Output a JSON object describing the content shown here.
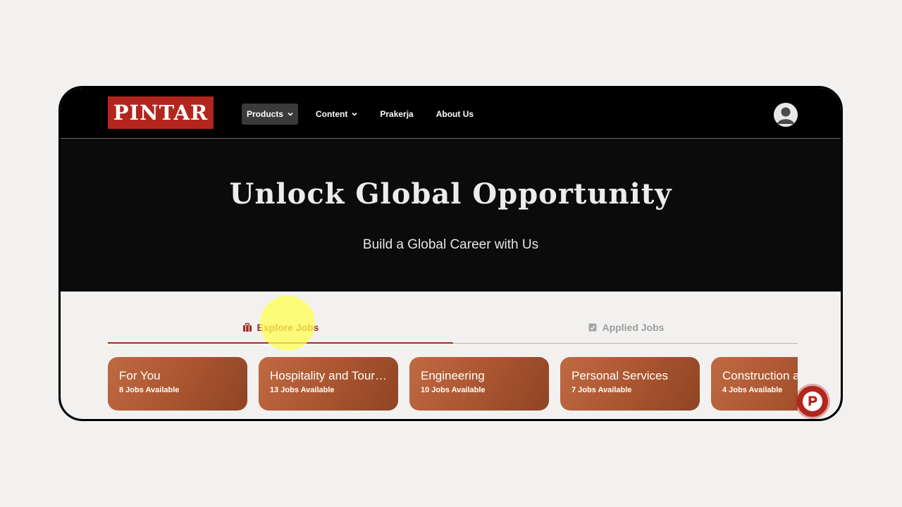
{
  "brand": {
    "logo_text": "PINTAR",
    "accent": "#b3261e"
  },
  "nav": {
    "items": [
      {
        "label": "Products",
        "has_dropdown": true,
        "active": true
      },
      {
        "label": "Content",
        "has_dropdown": true,
        "active": false
      },
      {
        "label": "Prakerja",
        "has_dropdown": false,
        "active": false
      },
      {
        "label": "About Us",
        "has_dropdown": false,
        "active": false
      }
    ],
    "avatar_icon": "user-avatar-icon"
  },
  "hero": {
    "title": "Unlock Global Opportunity",
    "subtitle": "Build a Global Career with Us"
  },
  "tabs": [
    {
      "label": "Explore Jobs",
      "icon": "briefcase-icon",
      "active": true
    },
    {
      "label": "Applied Jobs",
      "icon": "document-check-icon",
      "active": false
    }
  ],
  "categories": [
    {
      "title": "For You",
      "count": "8 Jobs Available"
    },
    {
      "title": "Hospitality and Tourism",
      "count": "13 Jobs Available"
    },
    {
      "title": "Engineering",
      "count": "10 Jobs Available"
    },
    {
      "title": "Personal Services",
      "count": "7 Jobs Available"
    },
    {
      "title": "Construction and Labor",
      "count": "4 Jobs Available"
    }
  ],
  "chat": {
    "icon": "chat-p-logo-icon"
  }
}
